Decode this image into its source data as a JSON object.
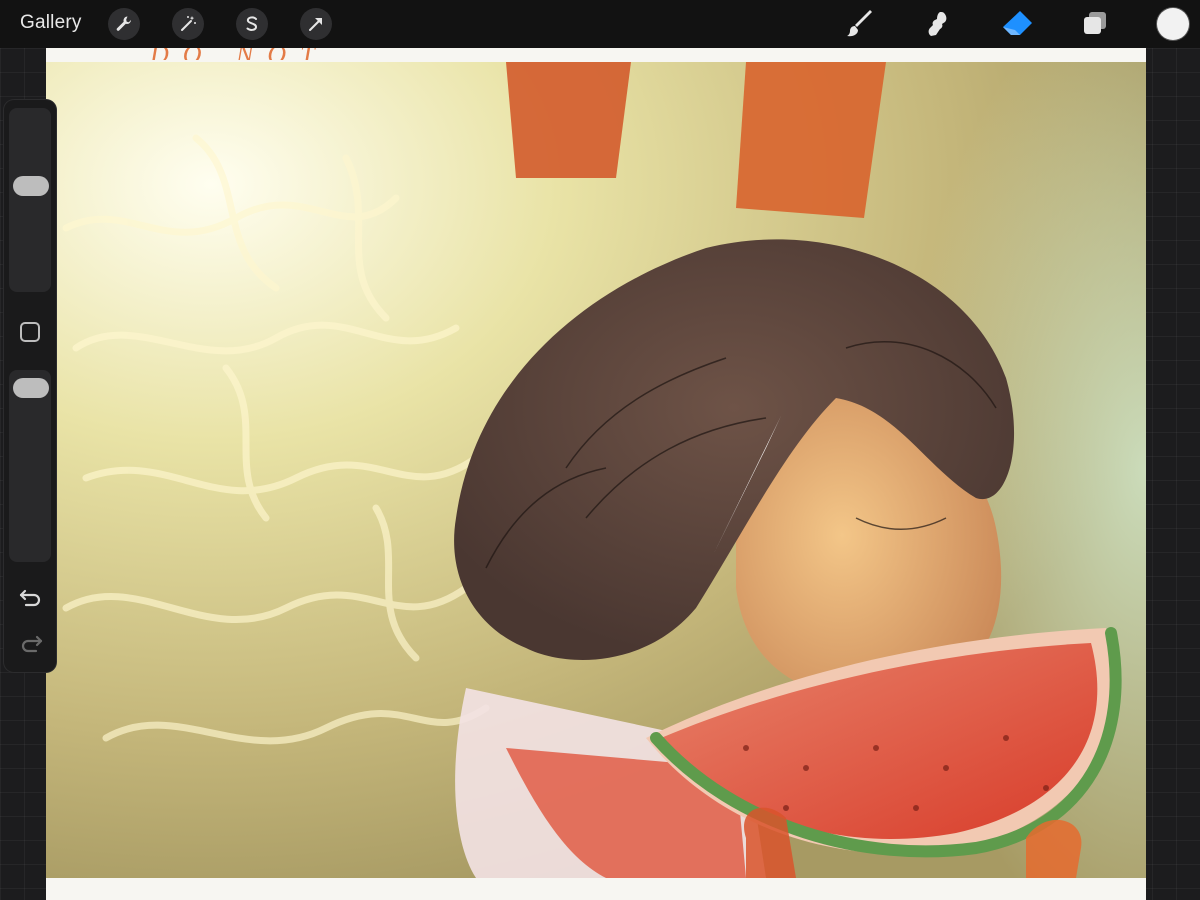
{
  "toolbar": {
    "gallery_label": "Gallery",
    "action_icons": [
      "wrench-icon",
      "magic-wand-icon",
      "selection-icon",
      "transform-arrow-icon"
    ],
    "tool_icons": [
      "brush-icon",
      "smudge-icon",
      "eraser-icon",
      "layers-icon"
    ],
    "active_tool": "eraser-icon",
    "active_color": "#1e90ff",
    "current_color": "#f2f2f2"
  },
  "canvas": {
    "sketch_note": "DO NOT REPLY",
    "sketch_color": "#e0662a"
  },
  "sidebar": {
    "brush_size_level": 0.45,
    "opacity_level": 0.0,
    "icons": [
      "modify-square-icon",
      "undo-icon",
      "redo-icon"
    ]
  }
}
